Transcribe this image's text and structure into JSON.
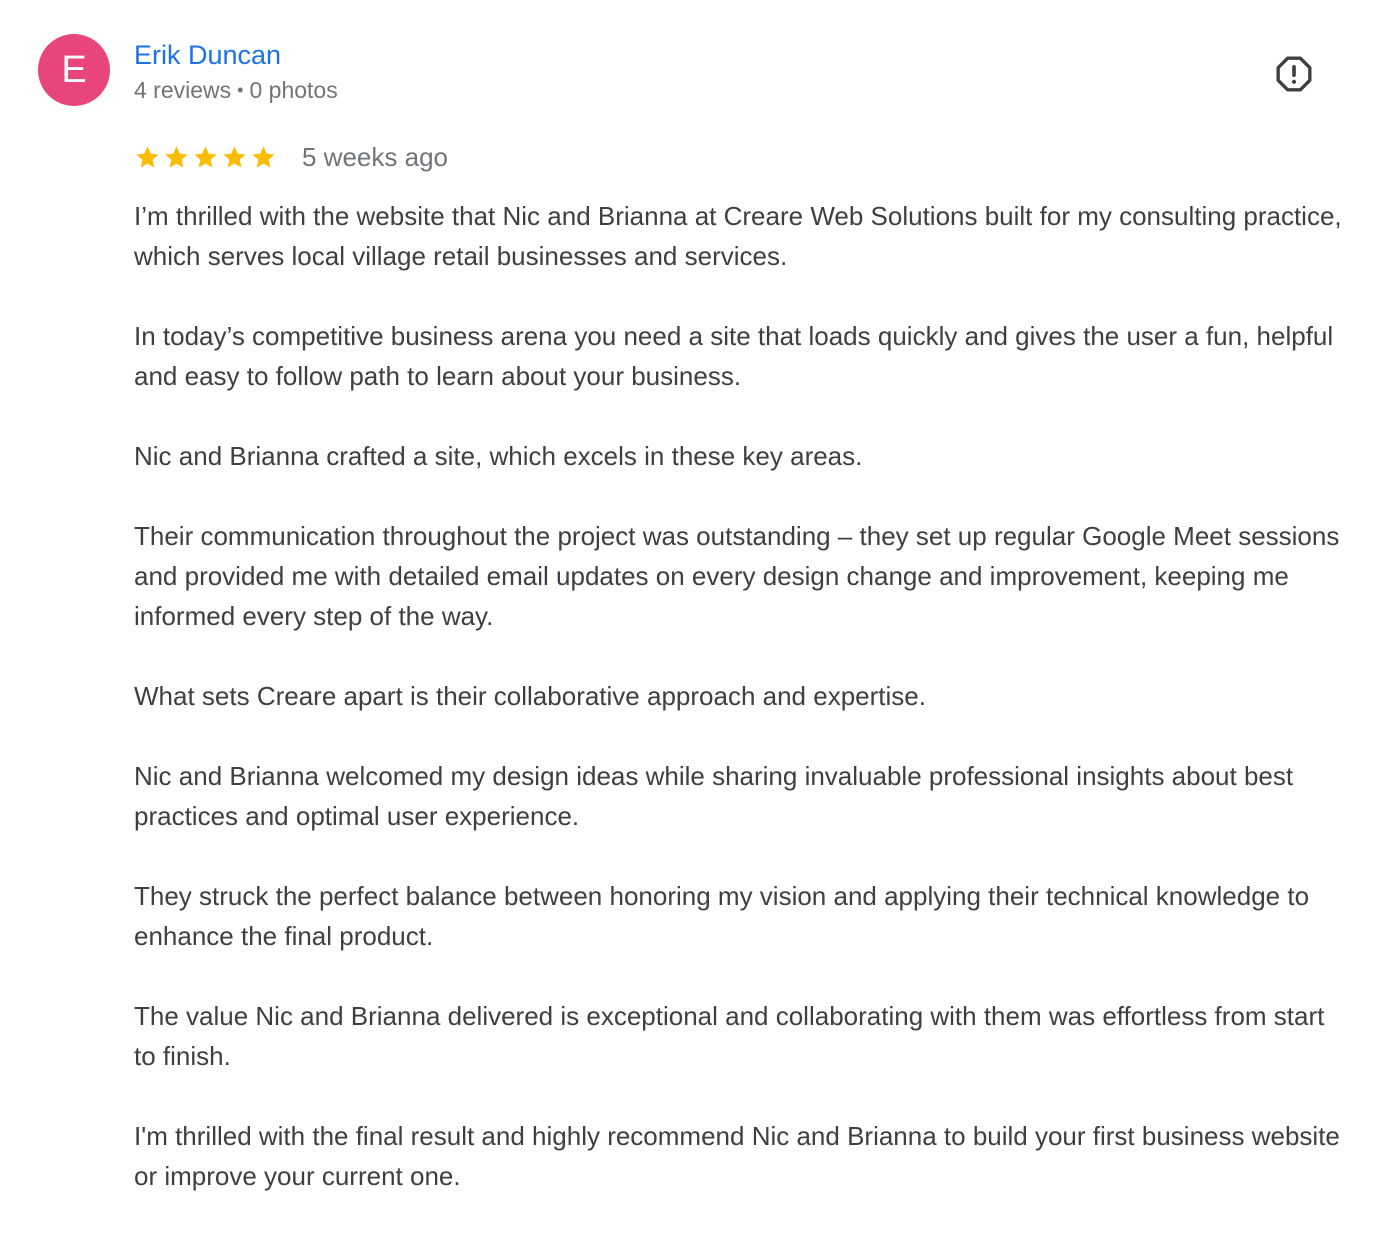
{
  "review": {
    "author": {
      "initial": "E",
      "name": "Erik Duncan",
      "reviews": "4 reviews",
      "separator": "•",
      "photos": "0 photos",
      "avatar_color": "#e8457b",
      "name_color": "#1a73e8"
    },
    "report_icon": "report-flag-icon",
    "rating": {
      "stars": 5,
      "max_stars": 5,
      "star_color": "#fbbc04",
      "date": "5 weeks ago"
    },
    "paragraphs": [
      "I’m thrilled with the website that Nic and Brianna at Creare Web Solutions built for my consulting practice, which serves local village retail businesses and services.",
      "In today’s competitive business arena you need a site that loads quickly and gives the user a fun, helpful and easy to follow path to learn about your business.",
      "Nic and Brianna crafted a site, which excels in these key areas.",
      "Their communication throughout the project was outstanding – they set up regular Google Meet sessions and provided me with detailed email updates on every design change and improvement, keeping me informed every step of the way.",
      "What sets Creare apart is their collaborative approach and expertise.",
      "Nic and Brianna welcomed my design ideas while sharing invaluable professional insights about best practices and optimal user experience.",
      "They struck the perfect balance between honoring my vision and applying their technical knowledge to enhance the final product.",
      "The value Nic and Brianna delivered is exceptional and collaborating with them was effortless from start to finish.",
      "I'm thrilled with the final result and highly recommend Nic and Brianna to build your first business website or improve your current one."
    ]
  }
}
